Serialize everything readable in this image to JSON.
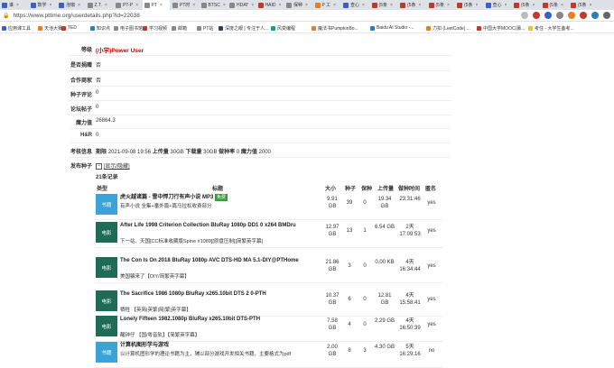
{
  "tabs": [
    {
      "label": "谁",
      "color": "#3a5fcd"
    },
    {
      "label": "数学",
      "color": "#3a5fcd"
    },
    {
      "label": "泡咖",
      "color": "#3a5fcd"
    },
    {
      "label": "Z.T.",
      "color": "#888"
    },
    {
      "label": "PT-P",
      "color": "#888"
    },
    {
      "label": "PT",
      "color": "#888",
      "active": true
    },
    {
      "label": "PT时",
      "color": "#888"
    },
    {
      "label": "BTSC",
      "color": "#888"
    },
    {
      "label": "HDAT",
      "color": "#888"
    },
    {
      "label": "HAID",
      "color": "#c0392b"
    },
    {
      "label": "保种",
      "color": "#888"
    },
    {
      "label": "P 工",
      "color": "#e67e22"
    },
    {
      "label": "查心",
      "color": "#3a5fcd"
    },
    {
      "label": "(5条",
      "color": "#c0392b"
    },
    {
      "label": "(5条",
      "color": "#c0392b"
    },
    {
      "label": "(5条",
      "color": "#c0392b"
    },
    {
      "label": "(5条",
      "color": "#c0392b"
    },
    {
      "label": "查心",
      "color": "#3a5fcd"
    },
    {
      "label": "(5条",
      "color": "#c0392b"
    },
    {
      "label": "(5条",
      "color": "#c0392b"
    },
    {
      "label": "(5条",
      "color": "#c0392b"
    }
  ],
  "address": {
    "url": "https://www.pttime.org/userdetails.php?id=22038"
  },
  "bookmarks": [
    {
      "label": "应用课工具",
      "color": "#3a5fcd"
    },
    {
      "label": "天池大赛",
      "color": "#e67e22"
    },
    {
      "label": "TED",
      "color": "#c0392b"
    },
    {
      "label": "知识点",
      "color": "#2980b9"
    },
    {
      "label": "电子图书馆",
      "color": "#888"
    },
    {
      "label": "学习视频",
      "color": "#c0392b"
    },
    {
      "label": "邮箱",
      "color": "#888"
    },
    {
      "label": "PT站",
      "color": "#888"
    },
    {
      "label": "深度之眼 | 专注于人...",
      "color": "#2c3e50"
    },
    {
      "label": "风变编程",
      "color": "#16a085"
    },
    {
      "label": "魔法书PumpkinBo...",
      "color": "#e67e22"
    },
    {
      "label": "Baidu AI Studio -...",
      "color": "#2980b9"
    },
    {
      "label": "力扣 (LeetCode) ...",
      "color": "#e67e22"
    },
    {
      "label": "中国大学MOOC(慕...",
      "color": "#c0392b"
    },
    {
      "label": "考住 - 大学生备考...",
      "color": "#f1c40f"
    }
  ],
  "profile": {
    "level_label": "等级",
    "level_value": "(小学)Power User",
    "donor_label": "是否捐赠",
    "donor_value": "否",
    "partner_label": "合作商家",
    "partner_value": "否",
    "comments_label": "种子评论",
    "comments_value": "0",
    "forum_label": "论坛帖子",
    "forum_value": "0",
    "magic_label": "魔力值",
    "magic_value": "26864.3",
    "hr_label": "H&R",
    "hr_value": "0",
    "exam_label": "考核信息",
    "exam_term_label": "期限",
    "exam_term_value": "2021-09-08 19:56",
    "exam_up_label": "上传量",
    "exam_up_value": "30GB",
    "exam_down_label": "下载量",
    "exam_down_value": "30GB",
    "exam_ratio_label": "做种率",
    "exam_ratio_value": "0",
    "exam_magic_label": "魔力值",
    "exam_magic_value": "2000",
    "seeds_label": "发布种子",
    "seeds_toggle": "[显示/隐藏]",
    "seeds_count": "21条记录"
  },
  "table": {
    "headers": {
      "type": "类型",
      "title": "标题",
      "size": "大小",
      "seeders": "种子",
      "leechers": "保种",
      "uploaded": "上传量",
      "seedtime": "做种时间",
      "anonymous": "匿名"
    },
    "rows": [
      {
        "type": "书籍",
        "type_color": "#3aa3d8",
        "title": "虎火越诸篇 - 雪中悍刀行有声小说 MP3",
        "tag": "免费",
        "subtitle": "有声小说 全集+番外篇+篇马拉松收费部分",
        "size": "9.91 GB",
        "seeders": "39",
        "leechers": "0",
        "uploaded": "19.34 GB",
        "seedtime": "23:31:46",
        "anonymous": "yes"
      },
      {
        "type": "电影",
        "type_color": "#1f6b55",
        "title": "After Life 1998 Criterion Collection BluRay 1080p DD1 0 x264 BMDru",
        "subtitle": "下一站、天国[CC标准收藏版Spine #1089][原盘压制][简繁英字幕]",
        "size": "12.97 GB",
        "seeders": "13",
        "leechers": "1",
        "uploaded": "6.54 GB",
        "seedtime": "2天 17:09:53",
        "anonymous": "yes"
      },
      {
        "type": "电影",
        "type_color": "#1f6b55",
        "title": "The Con Is On 2018 BluRay 1080p AVC DTS-HD MA 5.1-DIY@PTHome",
        "subtitle": "美国骗来了【DIY/简繁英字幕】",
        "size": "21.86 GB",
        "seeders": "3",
        "leechers": "0",
        "uploaded": "0.00 KB",
        "seedtime": "4天 16:34:44",
        "anonymous": "yes"
      },
      {
        "type": "电影",
        "type_color": "#1f6b55",
        "title": "The Sacrifice 1986 1080p BluRay x265.10bit DTS 2 0-PTH",
        "subtitle": "牺牲 【英简|英繁|简|繁|英字幕】",
        "size": "10.37 GB",
        "seeders": "6",
        "leechers": "0",
        "uploaded": "12.81 GB",
        "seedtime": "4天 15:58:41",
        "anonymous": "yes"
      },
      {
        "type": "电影",
        "type_color": "#1f6b55",
        "title": "Lonely Fifteen 1982.1080p BluRay x265.10bit DTS-PTH",
        "subtitle": "醒钟仔 【国/粤音轨】【简繁英字幕】",
        "size": "7.58 GB",
        "seeders": "4",
        "leechers": "0",
        "uploaded": "2.29 GB",
        "seedtime": "4天 16:50:39",
        "anonymous": "yes"
      },
      {
        "type": "书籍",
        "type_color": "#3aa3d8",
        "title": "计算机图形学与游戏",
        "subtitle": "以计算机图形学的理论书籍为主，辅以部分游戏开发相关书籍，主要格式为pdf",
        "size": "2.00 GB",
        "seeders": "8",
        "leechers": "3",
        "uploaded": "4.30 GB",
        "seedtime": "5天 16:29:16",
        "anonymous": "no"
      }
    ]
  }
}
